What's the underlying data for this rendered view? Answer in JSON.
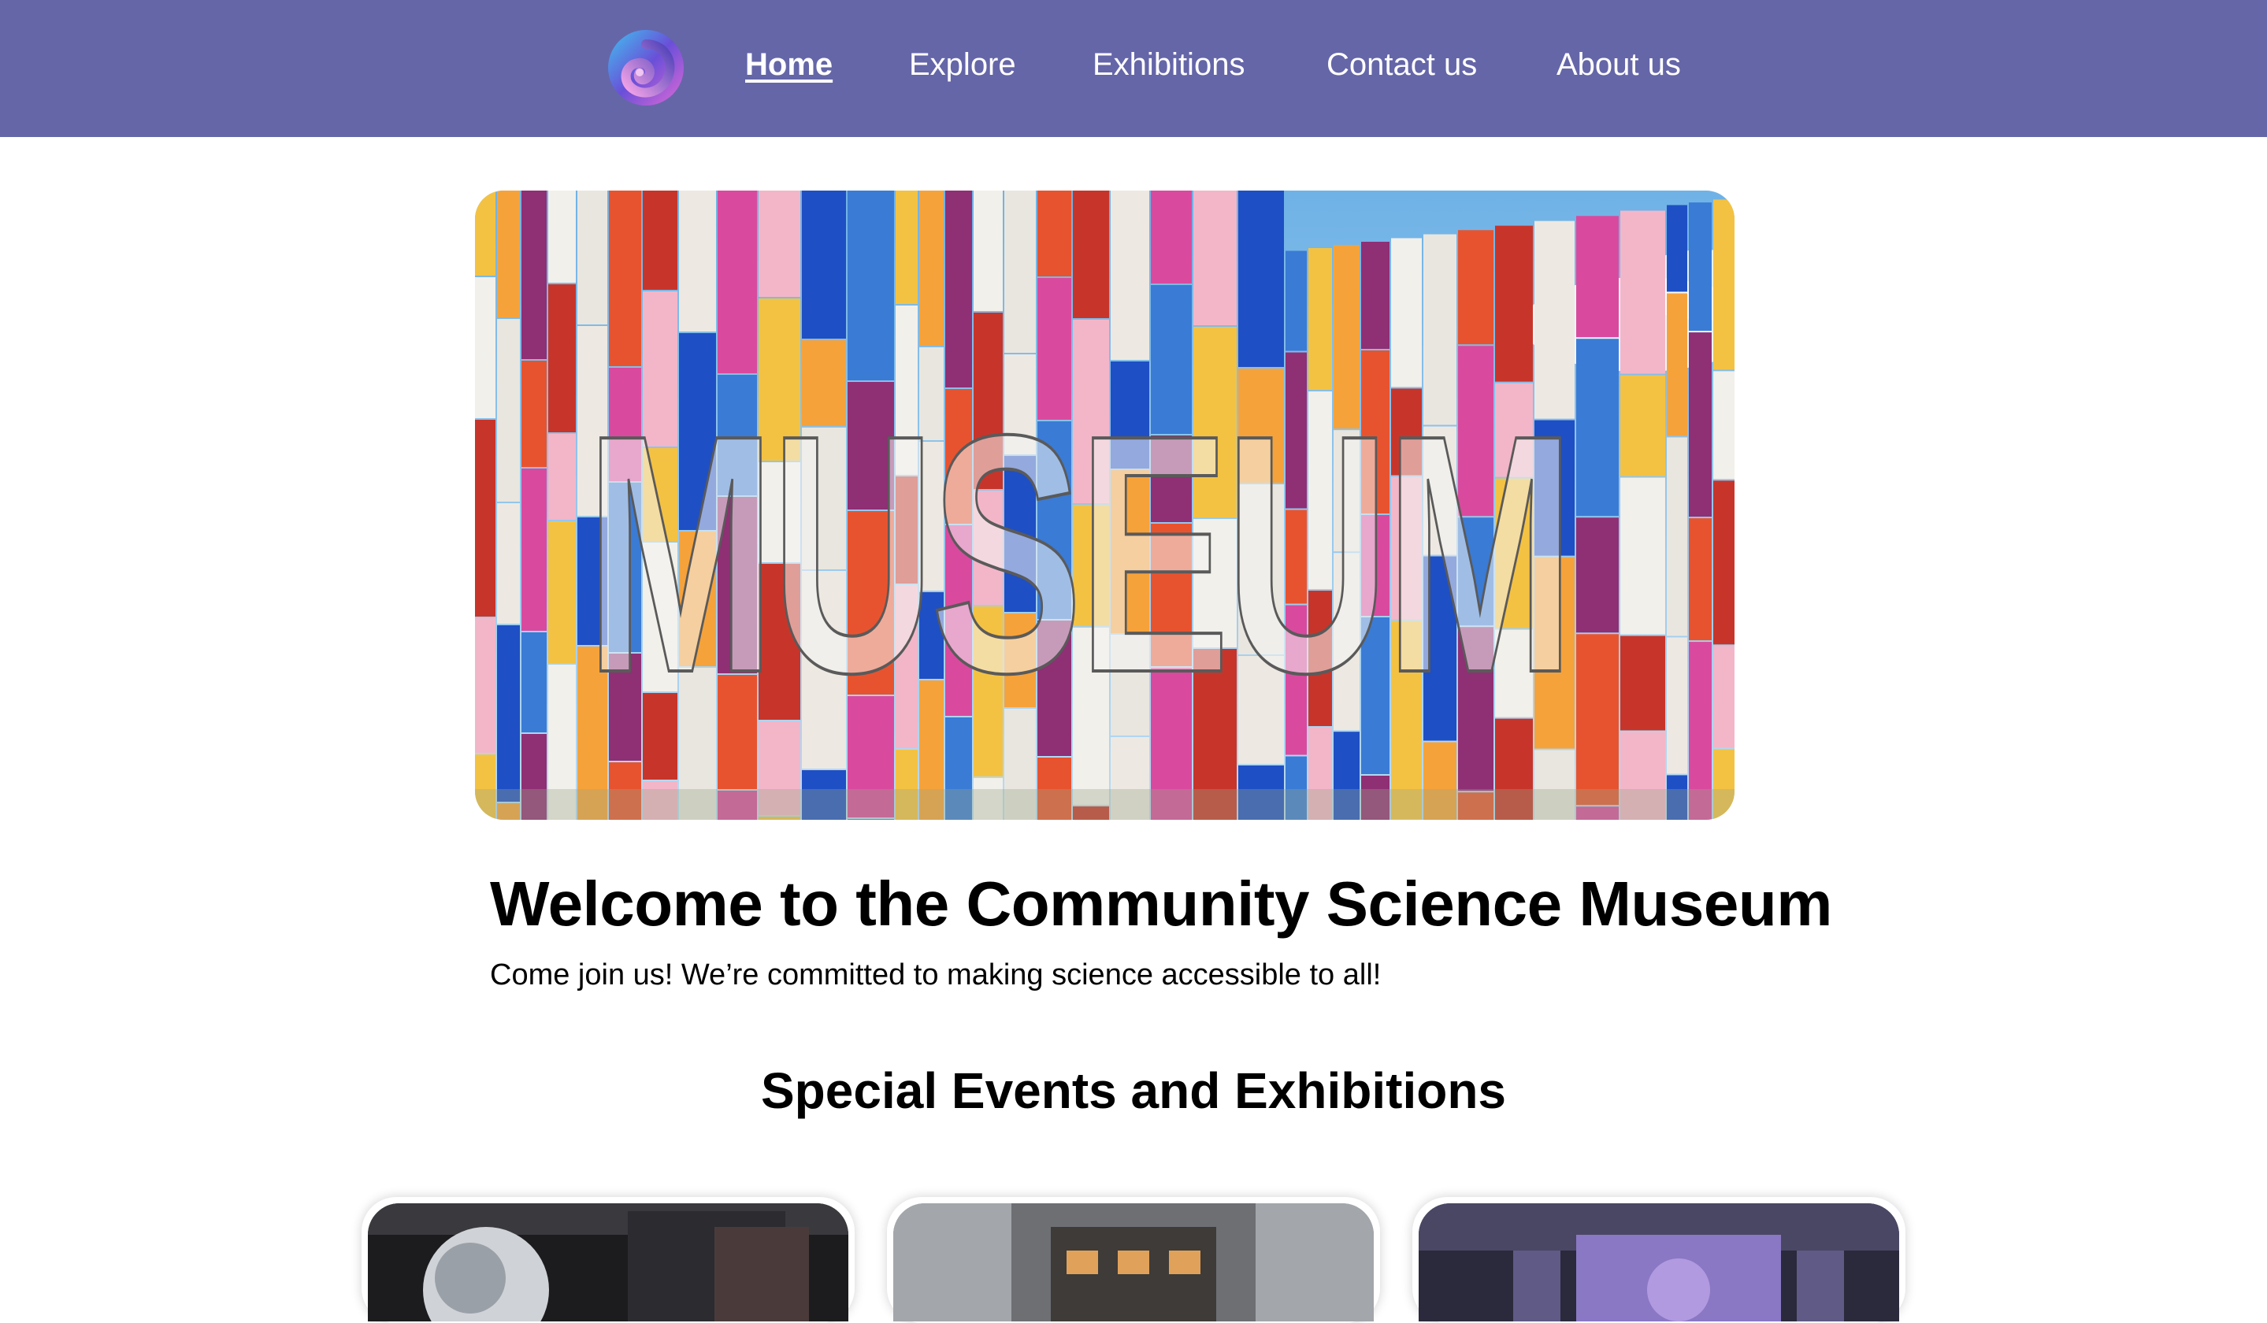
{
  "nav": {
    "logo_icon": "swirl-logo-icon",
    "items": [
      {
        "label": "Home",
        "active": true
      },
      {
        "label": "Explore",
        "active": false
      },
      {
        "label": "Exhibitions",
        "active": false
      },
      {
        "label": "Contact us",
        "active": false
      },
      {
        "label": "About us",
        "active": false
      }
    ]
  },
  "hero": {
    "image": "museum-facade-photo",
    "facade_text": "MUSEUM"
  },
  "main": {
    "title": "Welcome to the Community Science Museum",
    "subtitle": "Come join us! We’re committed to making science accessible to all!"
  },
  "events": {
    "heading": "Special Events and Exhibitions",
    "cards": [
      {
        "image": "space-exhibit-photo"
      },
      {
        "image": "museum-hall-photo"
      },
      {
        "image": "machine-exhibit-photo"
      }
    ]
  },
  "colors": {
    "navbar": "#6566a8",
    "nav_text": "#ffffff",
    "text": "#000000"
  }
}
